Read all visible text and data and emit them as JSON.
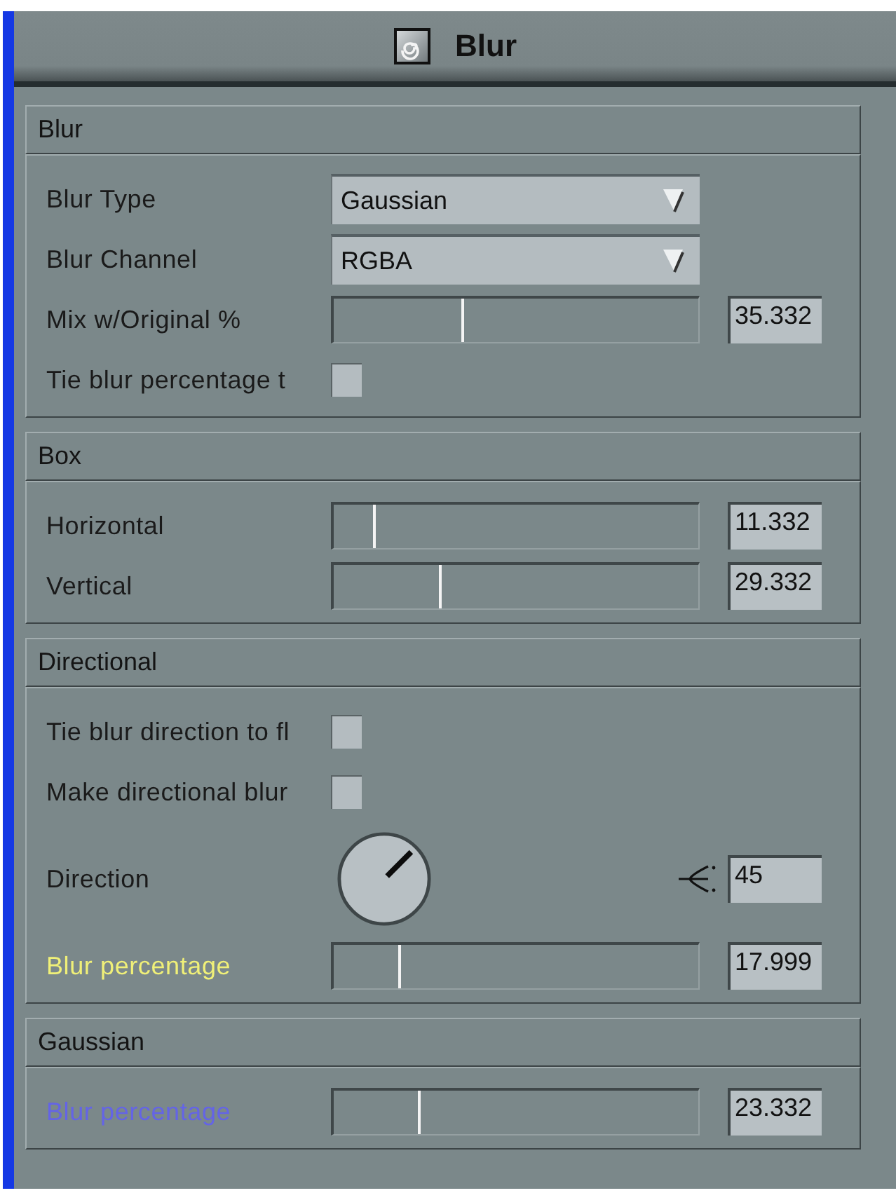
{
  "window": {
    "title": "Blur"
  },
  "sections": [
    {
      "title": "Blur",
      "rows": [
        {
          "kind": "dropdown",
          "label": "Blur Type",
          "value": "Gaussian"
        },
        {
          "kind": "dropdown",
          "label": "Blur Channel",
          "value": "RGBA"
        },
        {
          "kind": "slider",
          "label": "Mix w/Original %",
          "level": 0.353,
          "value": "35.332"
        },
        {
          "kind": "checkbox",
          "label": "Tie blur percentage t",
          "checked": false
        }
      ]
    },
    {
      "title": "Box",
      "rows": [
        {
          "kind": "slider",
          "label": "Horizontal",
          "level": 0.113,
          "value": "11.332"
        },
        {
          "kind": "slider",
          "label": "Vertical",
          "level": 0.293,
          "value": "29.332"
        }
      ]
    },
    {
      "title": "Directional",
      "rows": [
        {
          "kind": "checkbox",
          "label": "Tie blur direction to fl",
          "checked": false
        },
        {
          "kind": "checkbox",
          "label": "Make directional blur",
          "checked": false
        },
        {
          "kind": "dial",
          "label": "Direction",
          "value": "45"
        },
        {
          "kind": "slider",
          "label": "Blur percentage",
          "level": 0.18,
          "value": "17.999",
          "color": "#f0f078"
        }
      ]
    },
    {
      "title": "Gaussian",
      "rows": [
        {
          "kind": "slider",
          "label": "Blur percentage",
          "level": 0.233,
          "value": "23.332",
          "color": "#6464e6"
        }
      ]
    }
  ]
}
